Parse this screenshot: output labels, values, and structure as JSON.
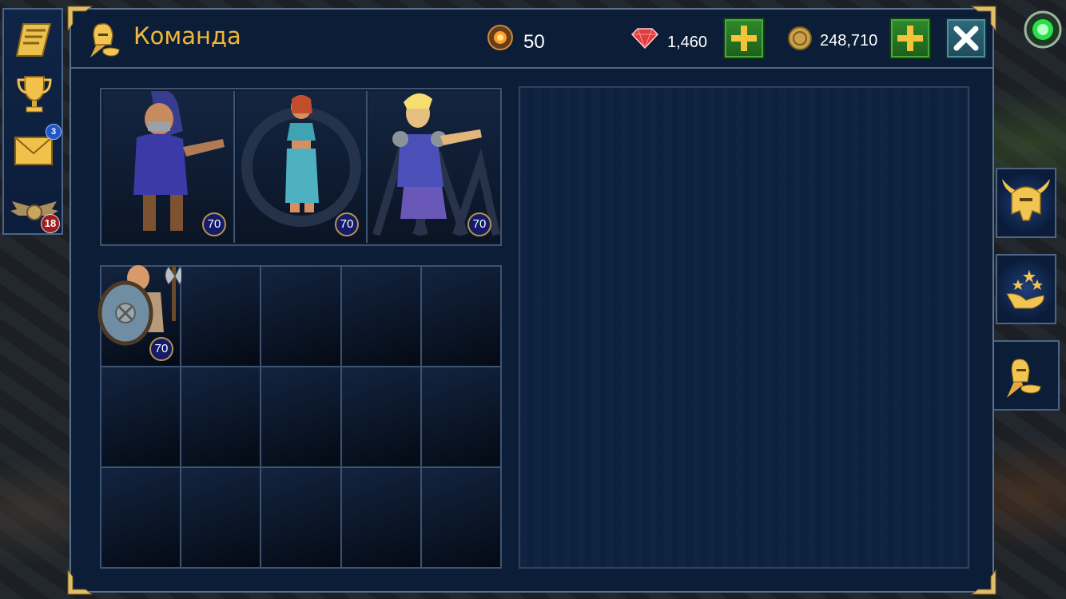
{
  "header": {
    "title": "Команда",
    "energy": "50",
    "gems": "1,460",
    "gold": "248,710"
  },
  "sidebar": {
    "mail_badge": "3",
    "rank_badge": "18"
  },
  "team": [
    {
      "name": "hooded-rogue",
      "level": "70"
    },
    {
      "name": "dancer",
      "level": "70"
    },
    {
      "name": "elf",
      "level": "70"
    }
  ],
  "roster": [
    {
      "name": "dwarf-warrior",
      "level": "70"
    }
  ],
  "colors": {
    "title": "#f2b73a",
    "panel": "#0c1d38",
    "border": "#5a7393",
    "plus": "#2f8a2b",
    "level_badge": "#141b6b"
  },
  "icons": {
    "left": [
      "scroll-icon",
      "trophy-icon",
      "mail-icon",
      "rank-wings-icon"
    ],
    "right_tabs": [
      "helmet-icon",
      "stars-hand-icon",
      "team-mask-icon"
    ]
  }
}
